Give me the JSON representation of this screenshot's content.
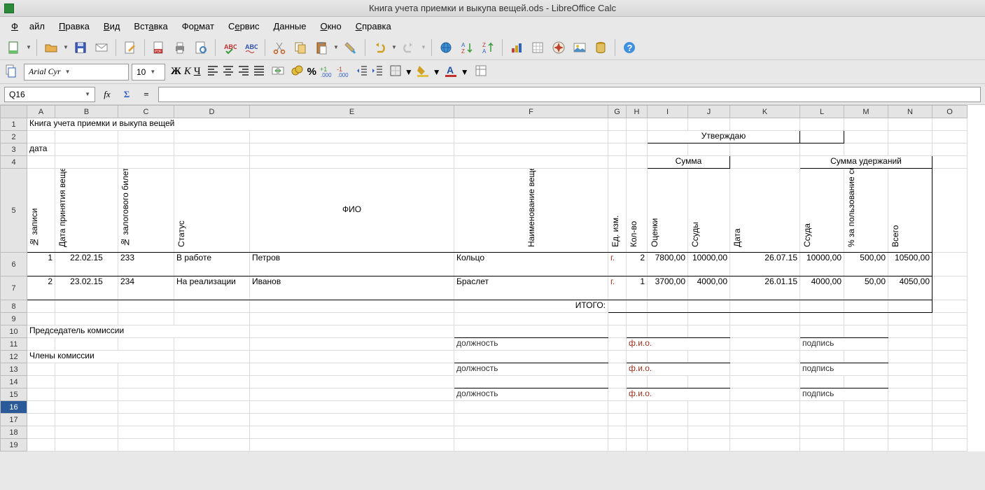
{
  "window": {
    "title": "Книга учета приемки и выкупа вещей.ods - LibreOffice Calc"
  },
  "menu": {
    "file": "Файл",
    "edit": "Правка",
    "view": "Вид",
    "insert": "Вставка",
    "format": "Формат",
    "service": "Сервис",
    "data": "Данные",
    "window": "Окно",
    "help": "Справка"
  },
  "toolbar2": {
    "font": "Arial Cyr",
    "size": "10",
    "bold": "Ж",
    "italic": "К",
    "underline": "Ч"
  },
  "formula": {
    "cellref": "Q16",
    "fx": "fx",
    "sigma": "Σ",
    "eq": "=",
    "input": ""
  },
  "cols": [
    "A",
    "B",
    "C",
    "D",
    "E",
    "F",
    "G",
    "H",
    "I",
    "J",
    "K",
    "L",
    "M",
    "N",
    "O"
  ],
  "rows": [
    "1",
    "2",
    "3",
    "4",
    "5",
    "6",
    "7",
    "8",
    "9",
    "10",
    "11",
    "12",
    "13",
    "14",
    "15",
    "16",
    "17",
    "18",
    "19"
  ],
  "doc": {
    "title": "Книга учета приемки и выкупа вещей",
    "approve": "Утверждаю",
    "date_label": "дата",
    "sum_head": "Сумма",
    "ded_head": "Сумма удержаний",
    "hdr": {
      "num": "№ записи",
      "take_date": "Дата принятия вещей под залог",
      "ticket": "№ залогового билета",
      "status": "Статус",
      "fio": "ФИО",
      "item": "Наименование вещей",
      "unit": "Ед. изм.",
      "qty": "Кол-во",
      "valuation": "Оценки",
      "loan": "Ссуды",
      "date2": "Дата",
      "ssuda": "Ссуда",
      "pct": "% за пользование ссудой",
      "total": "Всего"
    },
    "r1": {
      "n": "1",
      "d": "22.02.15",
      "t": "233",
      "s": "В работе",
      "f": "Петров",
      "it": "Кольцо",
      "u": "г.",
      "q": "2",
      "v": "7800,00",
      "l": "10000,00",
      "d2": "26.07.15",
      "ss": "10000,00",
      "p": "500,00",
      "tot": "10500,00"
    },
    "r2": {
      "n": "2",
      "d": "23.02.15",
      "t": "234",
      "s": "На реализации",
      "f": "Иванов",
      "it": "Браслет",
      "u": "г.",
      "q": "1",
      "v": "3700,00",
      "l": "4000,00",
      "d2": "26.01.15",
      "ss": "4000,00",
      "p": "50,00",
      "tot": "4050,00"
    },
    "itogo": "ИТОГО:",
    "chairman": "Председатель комиссии",
    "members": "Члены комиссии",
    "position": "должность",
    "fio_lbl": "ф.и.о.",
    "sign": "подпись"
  }
}
